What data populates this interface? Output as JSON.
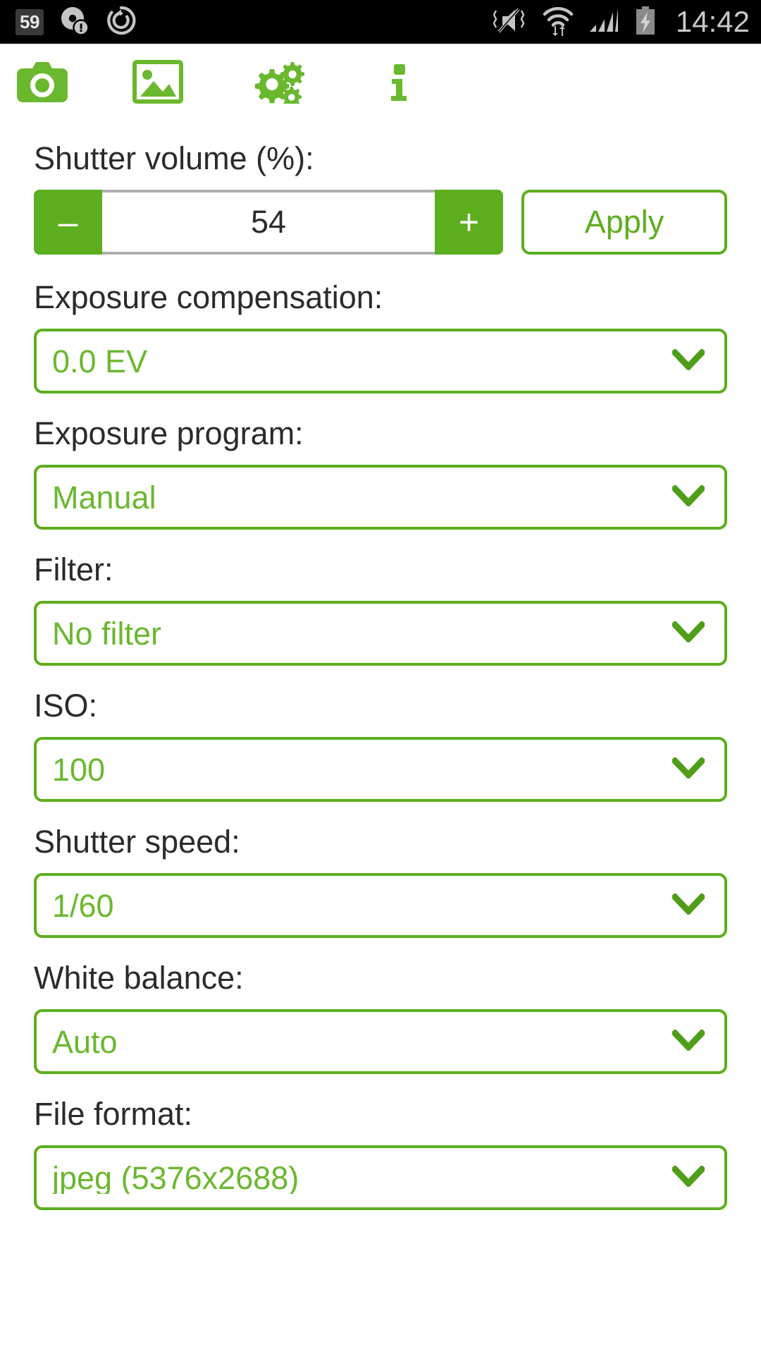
{
  "statusbar": {
    "badge": "59",
    "icons_left": [
      "notification-badge",
      "disc-warning-icon",
      "sync-icon"
    ],
    "icons_right": [
      "mute-vibrate-icon",
      "wifi-data-icon",
      "signal-bars-icon",
      "battery-charging-icon"
    ],
    "time": "14:42"
  },
  "tabs": [
    {
      "name": "camera",
      "icon": "camera-icon",
      "selected": true
    },
    {
      "name": "gallery",
      "icon": "image-icon",
      "selected": false
    },
    {
      "name": "settings",
      "icon": "gears-icon",
      "selected": false
    },
    {
      "name": "info",
      "icon": "info-icon",
      "selected": false
    }
  ],
  "colors": {
    "accent": "#5cae1e",
    "accent_text": "#6ab82e",
    "label_text": "#2b2b2b",
    "statusbar_bg": "#000000",
    "stepper_border": "#b0b0b0"
  },
  "fields": {
    "shutter_volume": {
      "label": "Shutter volume (%):",
      "value": "54",
      "minus_label": "–",
      "plus_label": "+",
      "apply_label": "Apply"
    },
    "exposure_compensation": {
      "label": "Exposure compensation:",
      "value": "0.0 EV"
    },
    "exposure_program": {
      "label": "Exposure program:",
      "value": "Manual"
    },
    "filter": {
      "label": "Filter:",
      "value": "No filter"
    },
    "iso": {
      "label": "ISO:",
      "value": "100"
    },
    "shutter_speed": {
      "label": "Shutter speed:",
      "value": "1/60"
    },
    "white_balance": {
      "label": "White balance:",
      "value": "Auto"
    },
    "file_format": {
      "label": "File format:",
      "value": "jpeg (5376x2688)"
    }
  }
}
